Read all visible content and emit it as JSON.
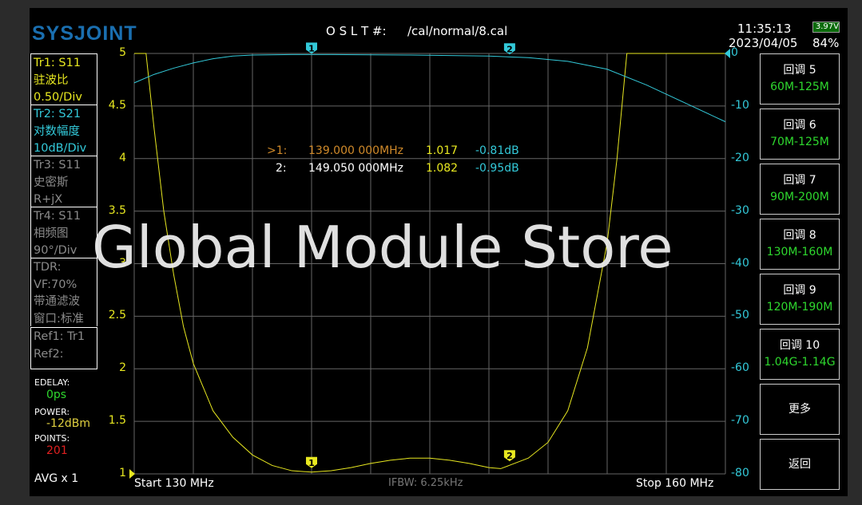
{
  "header": {
    "logo": "SYSJOINT",
    "cal_label": "O S L T #:",
    "cal_file": "/cal/normal/8.cal",
    "time": "11:35:13",
    "date": "2023/04/05",
    "battery_voltage": "3.97V",
    "battery_percent": "84%"
  },
  "traces": [
    {
      "line1": "Tr1:   S11",
      "line2": "驻波比",
      "line3": "0.50/Div",
      "color": "#e8e820"
    },
    {
      "line1": "Tr2:   S21",
      "line2": "对数幅度",
      "line3": "10dB/Div",
      "color": "#33c9d9"
    },
    {
      "line1": "Tr3:   S11",
      "line2": "史密斯",
      "line3": "R+jX",
      "color": "#8a8a8a"
    },
    {
      "line1": "Tr4:   S11",
      "line2": "相频图",
      "line3": "90°/Div",
      "color": "#8a8a8a"
    }
  ],
  "tdr": {
    "line1": "TDR:",
    "line2": "VF:70%",
    "line3": "带通滤波",
    "line4": "窗口:标准"
  },
  "refs": {
    "ref1": "Ref1:  Tr1",
    "ref2": "Ref2:"
  },
  "status": {
    "edelay_label": "EDELAY:",
    "edelay": "0ps",
    "power_label": "POWER:",
    "power": "-12dBm",
    "points_label": "POINTS:",
    "points": "201",
    "avg": "AVG x 1"
  },
  "footer": {
    "start": "Start   130 MHz",
    "ifbw": "IFBW: 6.25kHz",
    "stop": "Stop   160 MHz"
  },
  "markers": [
    {
      "label": ">1:",
      "freq": "139.000 000MHz",
      "swr": "1.017",
      "db": "-0.81dB",
      "id": "1",
      "f": 139.0,
      "swr_v": 1.017,
      "db_v": -0.81
    },
    {
      "label": "2:",
      "freq": "149.050 000MHz",
      "swr": "1.082",
      "db": "-0.95dB",
      "id": "2",
      "f": 149.05,
      "swr_v": 1.082,
      "db_v": -0.95
    }
  ],
  "buttons": [
    {
      "title": "回调 5",
      "sub": "60M-125M"
    },
    {
      "title": "回调 6",
      "sub": "70M-125M"
    },
    {
      "title": "回调 7",
      "sub": "90M-200M"
    },
    {
      "title": "回调 8",
      "sub": "130M-160M"
    },
    {
      "title": "回调 9",
      "sub": "120M-190M"
    },
    {
      "title": "回调 10",
      "sub": "1.04G-1.14G"
    },
    {
      "title": "更多",
      "sub": ""
    },
    {
      "title": "返回",
      "sub": ""
    }
  ],
  "watermark": "Global Module Store",
  "chart_data": {
    "type": "line",
    "xlim": [
      130,
      160
    ],
    "left_axis": {
      "ylim": [
        1,
        5
      ],
      "ticks": [
        "5",
        "4.5",
        "4",
        "3.5",
        "3",
        "2.5",
        "2",
        "1.5",
        "1"
      ]
    },
    "right_axis": {
      "ylim": [
        -80,
        0
      ],
      "ticks": [
        "0",
        "-10",
        "-20",
        "-30",
        "-40",
        "-50",
        "-60",
        "-70",
        "-80"
      ]
    },
    "series": [
      {
        "name": "Tr1 S11 SWR",
        "axis": "left",
        "color": "#e8e820",
        "x": [
          130,
          130.6,
          131,
          131.5,
          132,
          132.5,
          133,
          134,
          135,
          136,
          137,
          138,
          139,
          140,
          141,
          142,
          143,
          144,
          145,
          146,
          147,
          148,
          148.6,
          149.05,
          150,
          151,
          152,
          153,
          154,
          154.5,
          155,
          160
        ],
        "y": [
          5,
          5,
          4.3,
          3.5,
          2.9,
          2.4,
          2.05,
          1.6,
          1.35,
          1.18,
          1.08,
          1.03,
          1.017,
          1.03,
          1.06,
          1.1,
          1.13,
          1.15,
          1.15,
          1.13,
          1.1,
          1.06,
          1.05,
          1.082,
          1.15,
          1.3,
          1.6,
          2.2,
          3.2,
          4,
          5,
          5
        ]
      },
      {
        "name": "Tr2 S21 LogMag",
        "axis": "right",
        "color": "#33c9d9",
        "x": [
          130,
          131,
          132,
          133,
          134,
          135,
          136,
          138,
          140,
          144,
          148,
          150,
          152,
          154,
          156,
          158,
          160
        ],
        "y": [
          -5.6,
          -4,
          -2.8,
          -1.8,
          -1,
          -0.5,
          -0.3,
          -0.2,
          -0.2,
          -0.3,
          -0.5,
          -0.8,
          -1.5,
          -3,
          -6,
          -9.5,
          -13
        ]
      }
    ]
  }
}
